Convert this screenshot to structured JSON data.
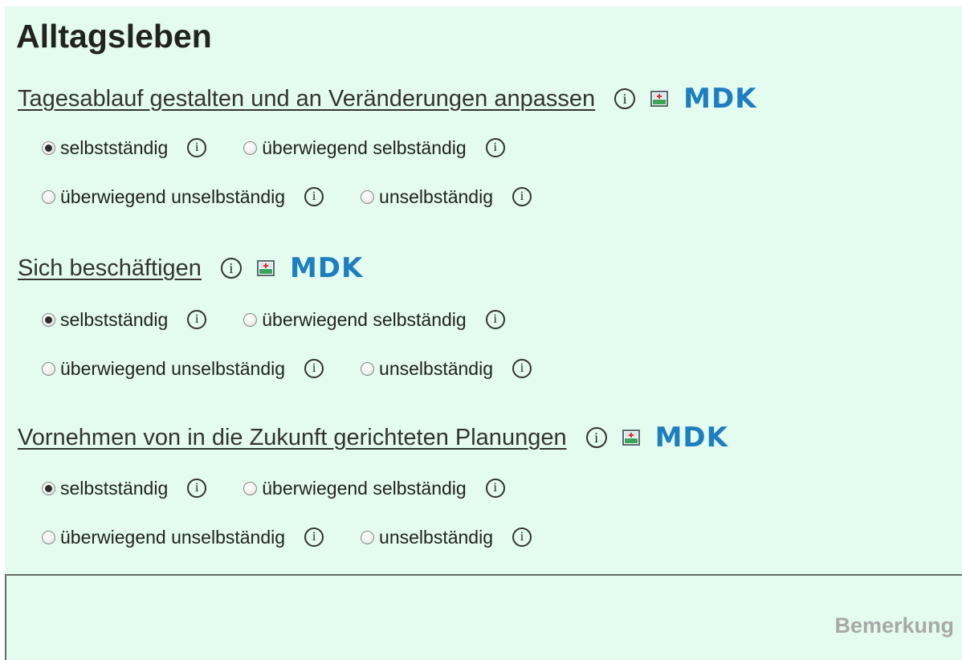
{
  "page": {
    "title": "Alltagsleben",
    "accent_color": "#1e7ec0",
    "background_color": "#e3fcef"
  },
  "sections": [
    {
      "title": "Tagesablauf gestalten und an Veränderungen anpassen",
      "info_label": "i",
      "mdk_label": "MDK",
      "options": [
        {
          "label": "selbstständig",
          "checked": true,
          "info_label": "i"
        },
        {
          "label": "überwiegend selbständig",
          "checked": false,
          "info_label": "i"
        },
        {
          "label": "überwiegend unselbständig",
          "checked": false,
          "info_label": "i"
        },
        {
          "label": "unselbständig",
          "checked": false,
          "info_label": "i"
        }
      ]
    },
    {
      "title": "Sich beschäftigen",
      "info_label": "i",
      "mdk_label": "MDK",
      "options": [
        {
          "label": "selbstständig",
          "checked": true,
          "info_label": "i"
        },
        {
          "label": "überwiegend selbständig",
          "checked": false,
          "info_label": "i"
        },
        {
          "label": "überwiegend unselbständig",
          "checked": false,
          "info_label": "i"
        },
        {
          "label": "unselbständig",
          "checked": false,
          "info_label": "i"
        }
      ]
    },
    {
      "title": "Vornehmen von in die Zukunft gerichteten Planungen",
      "info_label": "i",
      "mdk_label": "MDK",
      "options": [
        {
          "label": "selbstständig",
          "checked": true,
          "info_label": "i"
        },
        {
          "label": "überwiegend selbständig",
          "checked": false,
          "info_label": "i"
        },
        {
          "label": "überwiegend unselbständig",
          "checked": false,
          "info_label": "i"
        },
        {
          "label": "unselbständig",
          "checked": false,
          "info_label": "i"
        }
      ]
    }
  ],
  "remark": {
    "placeholder": "Bemerkung"
  },
  "icons": {
    "info": "info-circle-icon",
    "mdk_picture": "mdk-picture-icon"
  }
}
